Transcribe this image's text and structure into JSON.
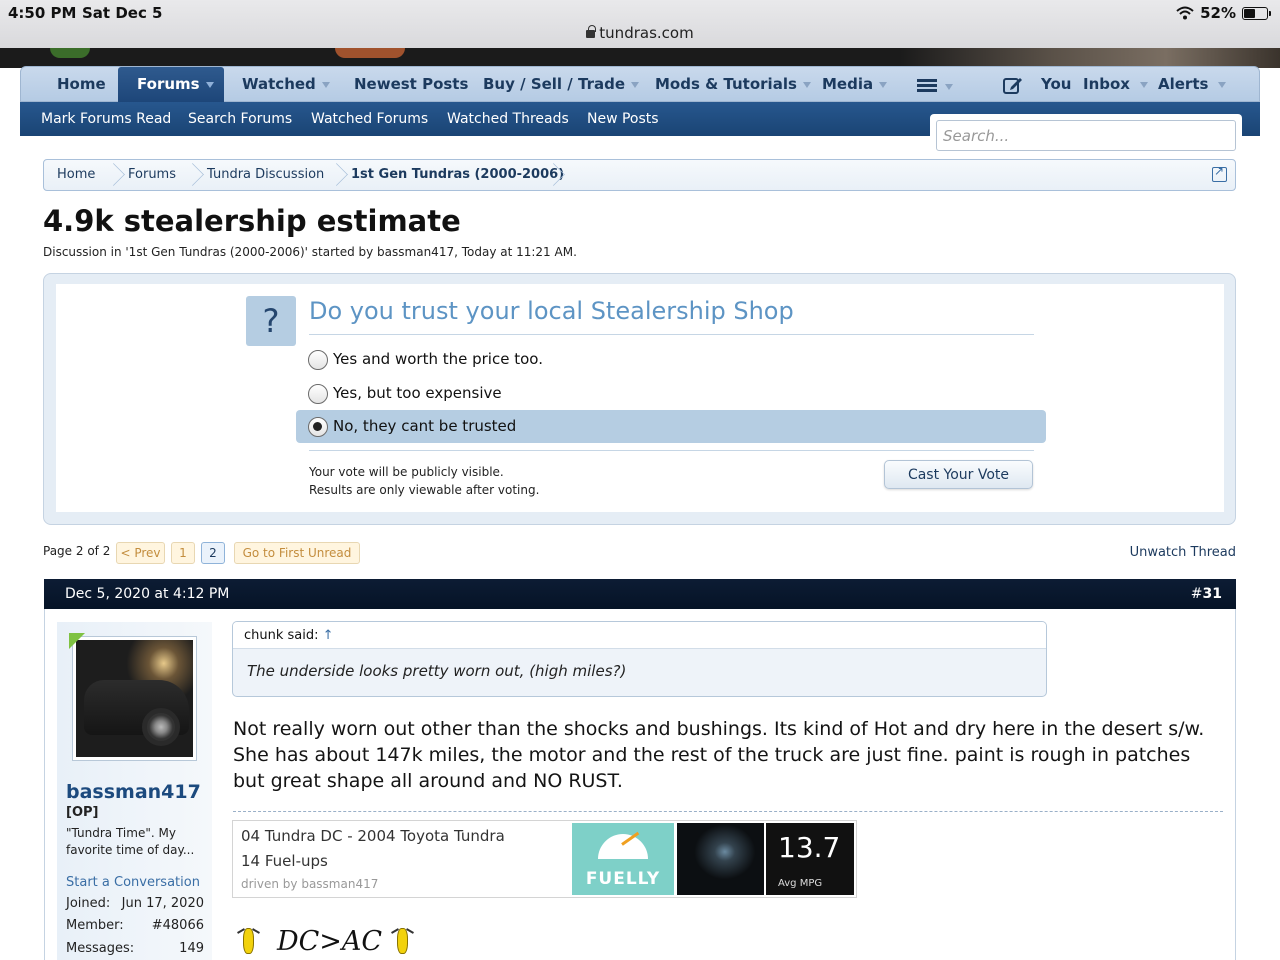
{
  "status_bar": {
    "time": "4:50 PM",
    "date": "Sat Dec 5",
    "battery": "52%",
    "battery_level": 0.52
  },
  "browser": {
    "url": "tundras.com"
  },
  "nav": {
    "items": [
      {
        "label": "Home"
      },
      {
        "label": "Forums"
      },
      {
        "label": "Watched"
      },
      {
        "label": "Newest Posts"
      },
      {
        "label": "Buy / Sell / Trade"
      },
      {
        "label": "Mods & Tutorials"
      },
      {
        "label": "Media"
      }
    ],
    "you": "You",
    "inbox": "Inbox",
    "alerts": "Alerts"
  },
  "subnav": {
    "items": [
      "Mark Forums Read",
      "Search Forums",
      "Watched Forums",
      "Watched Threads",
      "New Posts"
    ]
  },
  "search": {
    "placeholder": "Search..."
  },
  "breadcrumb": [
    "Home",
    "Forums",
    "Tundra Discussion",
    "1st Gen Tundras (2000-2006)"
  ],
  "thread": {
    "title": "4.9k stealership estimate",
    "meta": "Discussion in '1st Gen Tundras (2000-2006)' started by bassman417, Today at 11:21 AM."
  },
  "poll": {
    "icon": "?",
    "question": "Do you trust your local Stealership Shop",
    "options": [
      {
        "label": "Yes and worth the price too.",
        "selected": false
      },
      {
        "label": "Yes, but too expensive",
        "selected": false
      },
      {
        "label": "No, they cant be trusted",
        "selected": true
      }
    ],
    "note1": "Your vote will be publicly visible.",
    "note2": "Results are only viewable after voting.",
    "vote_button": "Cast Your Vote"
  },
  "pagination": {
    "info": "Page 2 of 2",
    "prev": "< Prev",
    "pages": [
      "1",
      "2"
    ],
    "current": "2",
    "first_unread": "Go to First Unread",
    "unwatch": "Unwatch Thread"
  },
  "post": {
    "date": "Dec 5, 2020 at 4:12 PM",
    "number_prefix": "#",
    "number": "31",
    "user": {
      "name": "bassman417",
      "badge": "[OP]",
      "title": "\"Tundra Time\". My favorite time of day...",
      "start_conversation": "Start a Conversation",
      "stats": [
        {
          "label": "Joined:",
          "value": "Jun 17, 2020"
        },
        {
          "label": "Member:",
          "value": "#48066"
        },
        {
          "label": "Messages:",
          "value": "149"
        }
      ]
    },
    "quote": {
      "author": "chunk said:",
      "arrow": "↑",
      "text": "The underside looks pretty worn out, (high miles?)"
    },
    "message": "Not really worn out other than the shocks and bushings. Its kind of Hot and dry here in the desert s/w. She has about 147k miles, the motor and the rest of the truck are just fine. paint is rough in patches but great shape all around and NO RUST.",
    "signature": {
      "fuelly": {
        "title": "04 Tundra DC - 2004 Toyota Tundra",
        "fuelups": "14 Fuel-ups",
        "driven_by": "driven by bassman417",
        "logo": "FUELLY",
        "mpg": "13.7",
        "mpg_label": "Avg MPG"
      },
      "text": "DC>AC"
    }
  }
}
